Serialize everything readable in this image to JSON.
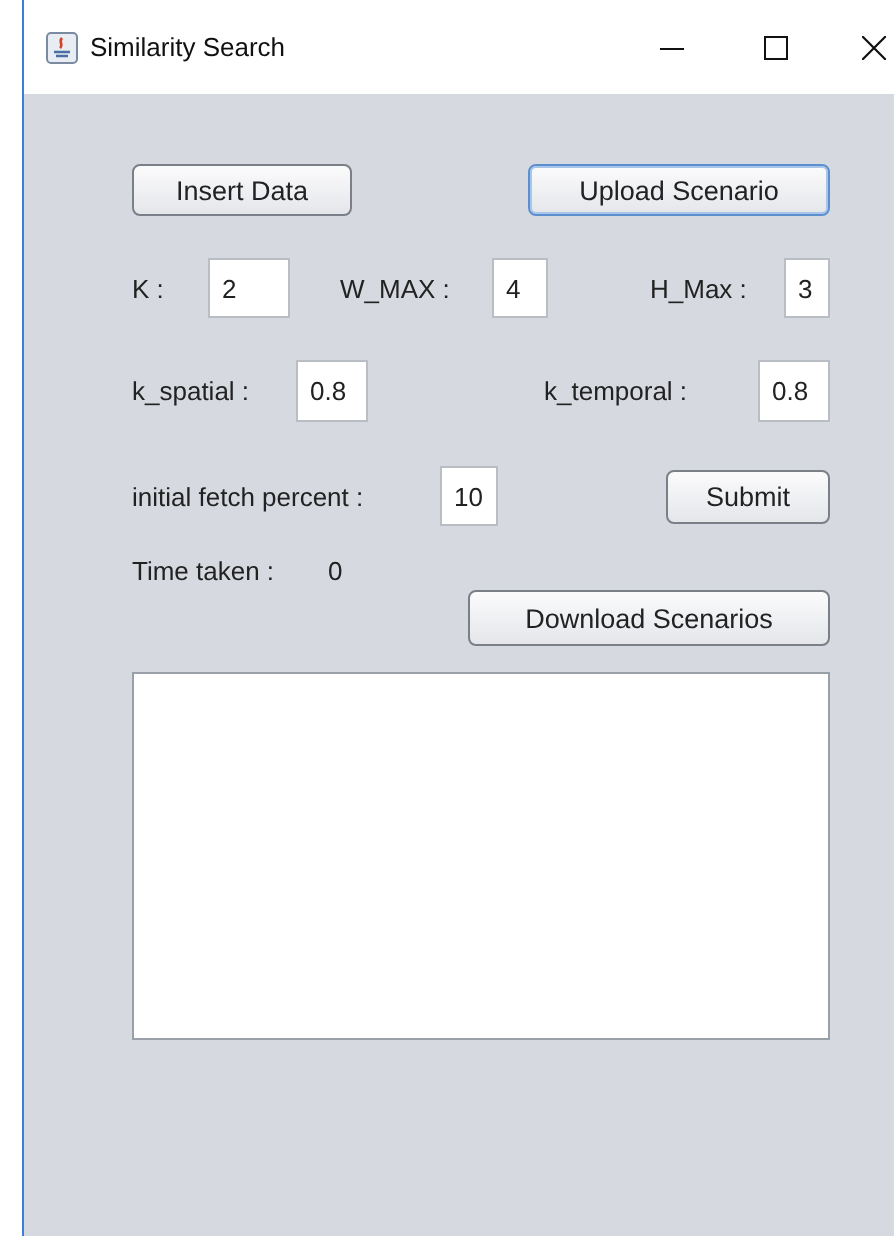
{
  "window": {
    "title": "Similarity Search"
  },
  "top_buttons": [
    {
      "label": "Insert Data",
      "focused": false
    },
    {
      "label": "Upload Scenario",
      "focused": true
    }
  ],
  "params_row1": [
    {
      "label": "K :",
      "value": "2"
    },
    {
      "label": "W_MAX :",
      "value": "4"
    },
    {
      "label": "H_Max :",
      "value": "3"
    }
  ],
  "params_row2": [
    {
      "label": "k_spatial :",
      "value": "0.8"
    },
    {
      "label": "k_temporal :",
      "value": "0.8"
    }
  ],
  "fetch": {
    "label": "initial fetch percent :",
    "value": "10"
  },
  "submit_button": {
    "label": "Submit",
    "focused": false
  },
  "time_taken": {
    "label": "Time taken :",
    "value": "0"
  },
  "download_button": {
    "label": "Download Scenarios",
    "focused": false
  }
}
